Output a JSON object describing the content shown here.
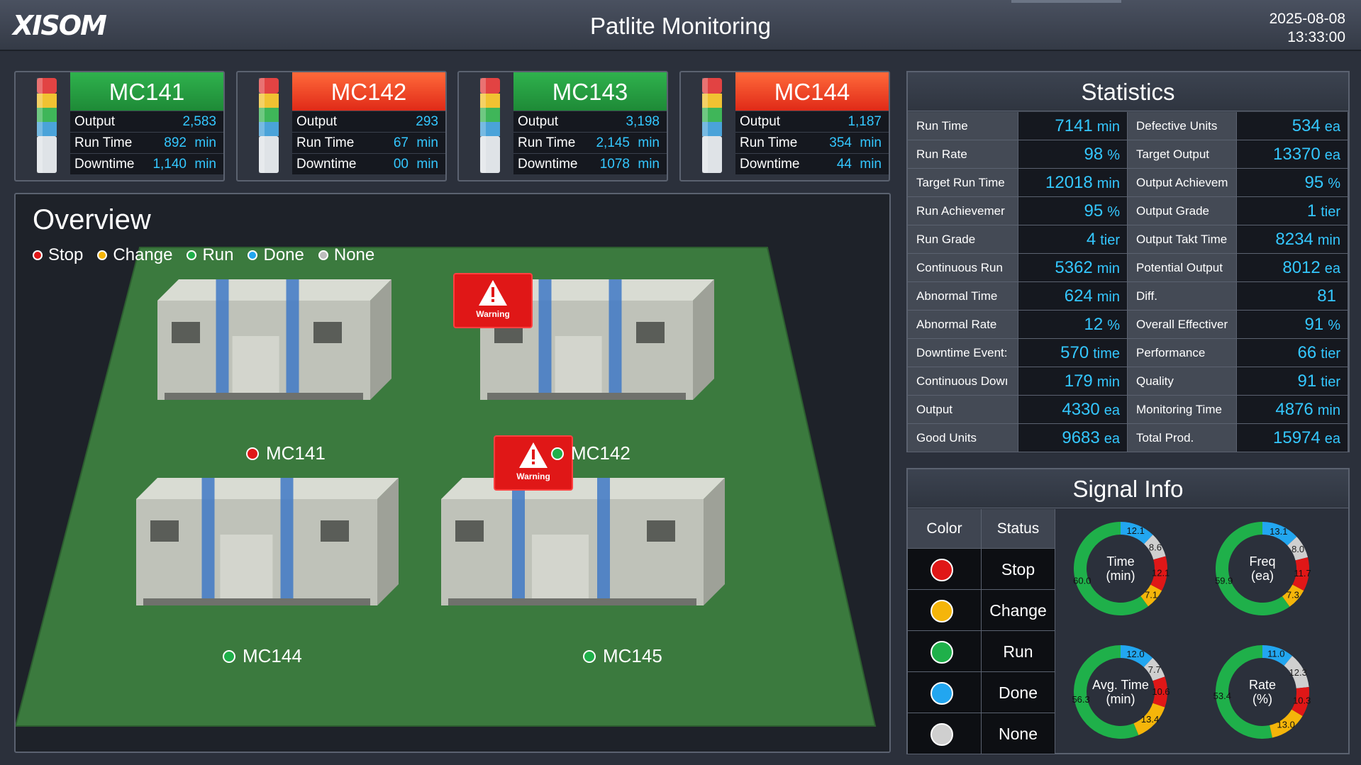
{
  "header": {
    "logo": "XISOM",
    "title": "Patlite Monitoring",
    "date": "2025-08-08",
    "time": "13:33:00"
  },
  "machines": [
    {
      "name": "MC141",
      "status_color": "#1e9a3c",
      "output_label": "Output",
      "output": "2,583",
      "runtime_label": "Run Time",
      "runtime": "892",
      "downtime_label": "Downtime",
      "downtime": "1,140",
      "unit": "min"
    },
    {
      "name": "MC142",
      "status_color": "#f04a25",
      "output_label": "Output",
      "output": "293",
      "runtime_label": "Run Time",
      "runtime": "67",
      "downtime_label": "Downtime",
      "downtime": "00",
      "unit": "min"
    },
    {
      "name": "MC143",
      "status_color": "#1e9a3c",
      "output_label": "Output",
      "output": "3,198",
      "runtime_label": "Run Time",
      "runtime": "2,145",
      "downtime_label": "Downtime",
      "downtime": "1078",
      "unit": "min"
    },
    {
      "name": "MC144",
      "status_color": "#f04a25",
      "output_label": "Output",
      "output": "1,187",
      "runtime_label": "Run Time",
      "runtime": "354",
      "downtime_label": "Downtime",
      "downtime": "44",
      "unit": "min"
    }
  ],
  "overview": {
    "title": "Overview",
    "legend": [
      {
        "label": "Stop",
        "color": "#e01717"
      },
      {
        "label": "Change",
        "color": "#f5b50a"
      },
      {
        "label": "Run",
        "color": "#1fb04a"
      },
      {
        "label": "Done",
        "color": "#22a6f0"
      },
      {
        "label": "None",
        "color": "#bdbdbd"
      }
    ],
    "machine_labels": [
      {
        "name": "MC141",
        "color": "#e01717"
      },
      {
        "name": "MC142",
        "color": "#1fb04a"
      },
      {
        "name": "MC144",
        "color": "#1fb04a"
      },
      {
        "name": "MC145",
        "color": "#1fb04a"
      }
    ],
    "warning_text": "Warning"
  },
  "statistics": {
    "title": "Statistics",
    "rows": [
      [
        {
          "label": "Run Time",
          "value": "7141",
          "unit": "min"
        },
        {
          "label": "Defective Units",
          "value": "534",
          "unit": "ea"
        }
      ],
      [
        {
          "label": "Run Rate",
          "value": "98",
          "unit": "%"
        },
        {
          "label": "Target Output",
          "value": "13370",
          "unit": "ea"
        }
      ],
      [
        {
          "label": "Target Run Time",
          "value": "12018",
          "unit": "min"
        },
        {
          "label": "Output Achievem",
          "value": "95",
          "unit": "%"
        }
      ],
      [
        {
          "label": "Run Achievemer",
          "value": "95",
          "unit": "%"
        },
        {
          "label": "Output Grade",
          "value": "1",
          "unit": "tier"
        }
      ],
      [
        {
          "label": "Run Grade",
          "value": "4",
          "unit": "tier"
        },
        {
          "label": "Output Takt Time",
          "value": "8234",
          "unit": "min"
        }
      ],
      [
        {
          "label": "Continuous Run",
          "value": "5362",
          "unit": "min"
        },
        {
          "label": "Potential Output",
          "value": "8012",
          "unit": "ea"
        }
      ],
      [
        {
          "label": "Abnormal Time",
          "value": "624",
          "unit": "min"
        },
        {
          "label": "Diff.",
          "value": "81",
          "unit": ""
        }
      ],
      [
        {
          "label": "Abnormal Rate",
          "value": "12",
          "unit": "%"
        },
        {
          "label": "Overall Effectiver",
          "value": "91",
          "unit": "%"
        }
      ],
      [
        {
          "label": "Downtime Event:",
          "value": "570",
          "unit": "time"
        },
        {
          "label": "Performance",
          "value": "66",
          "unit": "tier"
        }
      ],
      [
        {
          "label": "Continuous Dowı",
          "value": "179",
          "unit": "min"
        },
        {
          "label": "Quality",
          "value": "91",
          "unit": "tier"
        }
      ],
      [
        {
          "label": "Output",
          "value": "4330",
          "unit": "ea"
        },
        {
          "label": "Monitoring Time",
          "value": "4876",
          "unit": "min"
        }
      ],
      [
        {
          "label": "Good Units",
          "value": "9683",
          "unit": "ea"
        },
        {
          "label": "Total Prod.",
          "value": "15974",
          "unit": "ea"
        }
      ]
    ]
  },
  "signal_info": {
    "title": "Signal Info",
    "col_color": "Color",
    "col_status": "Status",
    "rows": [
      {
        "status": "Stop",
        "color": "#e01717"
      },
      {
        "status": "Change",
        "color": "#f5b50a"
      },
      {
        "status": "Run",
        "color": "#1fb04a"
      },
      {
        "status": "Done",
        "color": "#22a6f0"
      },
      {
        "status": "None",
        "color": "#cfcfcf"
      }
    ]
  },
  "chart_data": [
    {
      "type": "pie",
      "title": "Time\n(min)",
      "title_lines": [
        "Time",
        "(min)"
      ],
      "categories": [
        "Run",
        "Done",
        "None",
        "Stop",
        "Change"
      ],
      "values": [
        60.0,
        12.1,
        8.6,
        12.1,
        7.1
      ],
      "labels": [
        "60.0",
        "12.1",
        "8.6",
        "12.1",
        "7.1"
      ],
      "colors": [
        "#1fb04a",
        "#22a6f0",
        "#cfcfcf",
        "#e01717",
        "#f5b50a"
      ]
    },
    {
      "type": "pie",
      "title": "Freq\n(ea)",
      "title_lines": [
        "Freq",
        "(ea)"
      ],
      "categories": [
        "Run",
        "Done",
        "None",
        "Stop",
        "Change"
      ],
      "values": [
        59.9,
        13.1,
        8.0,
        11.7,
        7.3
      ],
      "labels": [
        "59.9",
        "13.1",
        "8.0",
        "11.7",
        "7.3"
      ],
      "colors": [
        "#1fb04a",
        "#22a6f0",
        "#cfcfcf",
        "#e01717",
        "#f5b50a"
      ]
    },
    {
      "type": "pie",
      "title": "Avg. Time\n(min)",
      "title_lines": [
        "Avg. Time",
        "(min)"
      ],
      "categories": [
        "Run",
        "Done",
        "None",
        "Stop",
        "Change"
      ],
      "values": [
        56.3,
        12.0,
        7.7,
        10.6,
        13.4
      ],
      "labels": [
        "56.3",
        "12.0",
        "7.7",
        "10.6",
        "13.4"
      ],
      "colors": [
        "#1fb04a",
        "#22a6f0",
        "#cfcfcf",
        "#e01717",
        "#f5b50a"
      ]
    },
    {
      "type": "pie",
      "title": "Rate\n(%)",
      "title_lines": [
        "Rate",
        "(%)"
      ],
      "categories": [
        "Run",
        "Done",
        "None",
        "Stop",
        "Change"
      ],
      "values": [
        53.4,
        11.0,
        12.3,
        10.3,
        13.0
      ],
      "labels": [
        "53.4",
        "11.0",
        "12.3",
        "10.3",
        "13.0"
      ],
      "colors": [
        "#1fb04a",
        "#22a6f0",
        "#cfcfcf",
        "#e01717",
        "#f5b50a"
      ]
    }
  ]
}
